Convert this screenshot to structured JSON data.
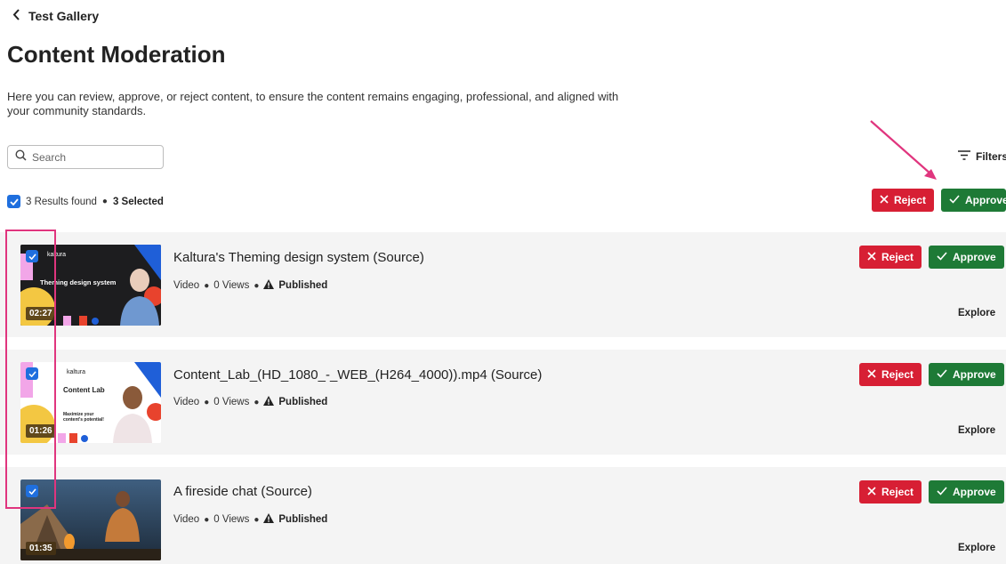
{
  "nav": {
    "back_label": "Test Gallery"
  },
  "page": {
    "title": "Content Moderation",
    "description": "Here you can review, approve, or reject content, to ensure the content remains engaging, professional, and aligned with your community standards."
  },
  "search": {
    "placeholder": "Search"
  },
  "filters": {
    "label": "Filters"
  },
  "results": {
    "found_label": "3 Results found",
    "selected_label": "3 Selected"
  },
  "bulk_actions": {
    "reject_label": "Reject",
    "approve_label": "Approve"
  },
  "colors": {
    "reject": "#d71f34",
    "approve": "#1e7a36",
    "checkbox": "#1f6fde",
    "highlight": "#e0357e"
  },
  "entries": [
    {
      "title": "Kaltura's Theming design system (Source)",
      "type": "Video",
      "views": "0 Views",
      "status": "Published",
      "duration": "02:27",
      "thumb_brand": "kaltura",
      "thumb_caption": "Theming design system",
      "reject_label": "Reject",
      "approve_label": "Approve",
      "explore_label": "Explore"
    },
    {
      "title": "Content_Lab_(HD_1080_-_WEB_(H264_4000)).mp4 (Source)",
      "type": "Video",
      "views": "0 Views",
      "status": "Published",
      "duration": "01:26",
      "thumb_brand": "kaltura",
      "thumb_caption": "Content Lab",
      "thumb_subcaption": "Maximize your content's potential!",
      "reject_label": "Reject",
      "approve_label": "Approve",
      "explore_label": "Explore"
    },
    {
      "title": "A fireside chat (Source)",
      "type": "Video",
      "views": "0 Views",
      "status": "Published",
      "duration": "01:35",
      "reject_label": "Reject",
      "approve_label": "Approve",
      "explore_label": "Explore"
    }
  ]
}
